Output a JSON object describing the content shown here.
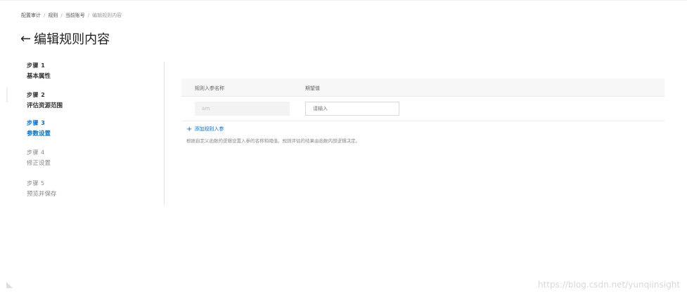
{
  "breadcrumb": {
    "items": [
      "配置审计",
      "规则",
      "当前账号"
    ],
    "current": "编辑规则内容"
  },
  "page": {
    "back_icon": "←",
    "title": "编辑规则内容"
  },
  "steps": [
    {
      "num": "步骤 1",
      "name": "基本属性",
      "state": "done"
    },
    {
      "num": "步骤 2",
      "name": "评估资源范围",
      "state": "done"
    },
    {
      "num": "步骤 3",
      "name": "参数设置",
      "state": "active"
    },
    {
      "num": "步骤 4",
      "name": "修正设置",
      "state": "future"
    },
    {
      "num": "步骤 5",
      "name": "预览并保存",
      "state": "future"
    }
  ],
  "params_table": {
    "headers": [
      "规则入参名称",
      "期望值"
    ],
    "row": {
      "name_value": "arn",
      "expected_placeholder": "请输入"
    }
  },
  "add_param": {
    "icon": "+",
    "label": "添加规则入参"
  },
  "hint": "根据自定义函数的逻辑设置入参的名称和阈值。规则评估的结果由函数内部逻辑决定。",
  "watermark": "https://blog.csdn.net/yunqiinsight",
  "colors": {
    "accent": "#0070cc",
    "header_bg": "#f7f7f7"
  }
}
